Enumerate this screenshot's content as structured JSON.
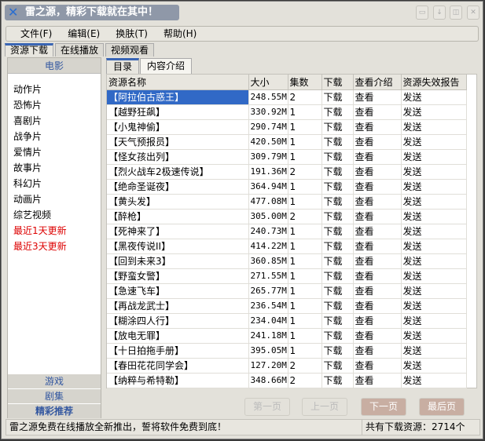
{
  "title": "雷之源，精彩下载就在其中！",
  "window_buttons": [
    "▭",
    "↓",
    "◫",
    "✕"
  ],
  "menu": [
    "文件(F)",
    "编辑(E)",
    "换肤(T)",
    "帮助(H)"
  ],
  "tabs": [
    "资源下载",
    "在线播放",
    "视频观看"
  ],
  "sidebar": {
    "header": "电影",
    "items": [
      "动作片",
      "恐怖片",
      "喜剧片",
      "战争片",
      "爱情片",
      "故事片",
      "科幻片",
      "动画片",
      "综艺视频"
    ],
    "red_items": [
      "最近1天更新",
      "最近3天更新"
    ],
    "buttons": [
      "游戏",
      "剧集",
      "精彩推荐"
    ]
  },
  "inner_tabs": [
    "目录",
    "内容介绍"
  ],
  "columns": [
    "资源名称",
    "大小",
    "集数",
    "下载",
    "查看介绍",
    "资源失效报告"
  ],
  "rows": [
    [
      "【阿拉伯古惑王】",
      "248.55M",
      "2"
    ],
    [
      "【越野狂飙】",
      "330.92M",
      "1"
    ],
    [
      "【小鬼神偷】",
      "290.74M",
      "1"
    ],
    [
      "【天气预报员】",
      "420.50M",
      "1"
    ],
    [
      "【怪女孩出列】",
      "309.79M",
      "1"
    ],
    [
      "【烈火战车2极速传说】",
      "191.36M",
      "2"
    ],
    [
      "【绝命圣诞夜】",
      "364.94M",
      "1"
    ],
    [
      "【黄头发】",
      "477.08M",
      "1"
    ],
    [
      "【醉枪】",
      "305.00M",
      "2"
    ],
    [
      "【死神来了】",
      "240.73M",
      "1"
    ],
    [
      "【黑夜传说II】",
      "414.22M",
      "1"
    ],
    [
      "【回到未来3】",
      "360.85M",
      "1"
    ],
    [
      "【野蛮女警】",
      "271.55M",
      "1"
    ],
    [
      "【急速飞车】",
      "265.77M",
      "1"
    ],
    [
      "【再战龙武士】",
      "236.54M",
      "1"
    ],
    [
      "【糊涂四人行】",
      "234.04M",
      "1"
    ],
    [
      "【放电无罪】",
      "241.18M",
      "1"
    ],
    [
      "【十日拍拖手册】",
      "395.05M",
      "1"
    ],
    [
      "【春田花花同学会】",
      "127.20M",
      "2"
    ],
    [
      "【纳粹与希特勒】",
      "348.66M",
      "2"
    ]
  ],
  "row_actions": {
    "download": "下载",
    "view": "查看",
    "report": "发送"
  },
  "pager": [
    "第一页",
    "上一页",
    "下一页",
    "最后页"
  ],
  "status": {
    "left": "雷之源免费在线播放全新推出，誓将软件免费到底！",
    "right": "共有下载资源：2714个"
  }
}
